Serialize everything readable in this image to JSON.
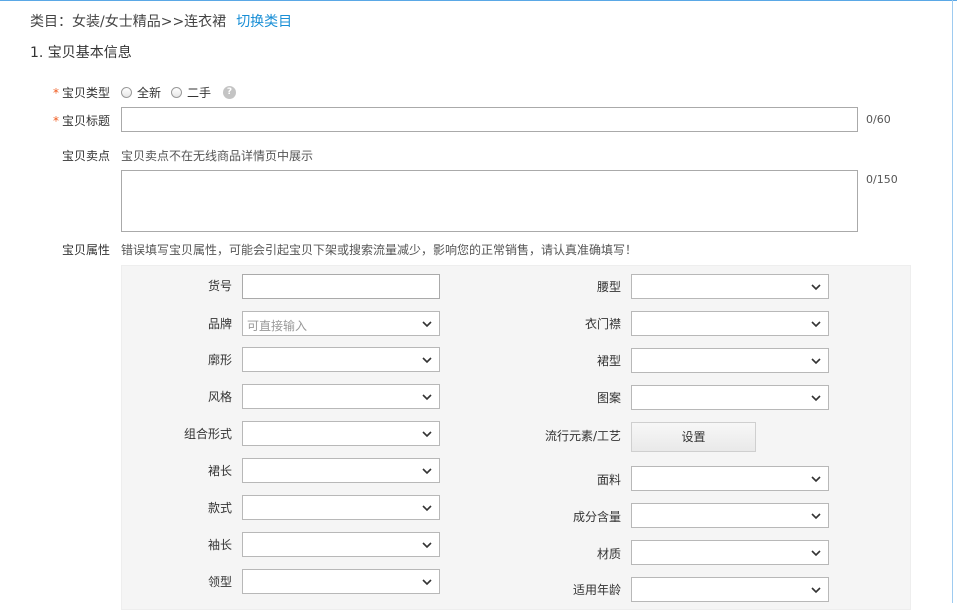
{
  "category": {
    "label": "类目：女装/女士精品>>连衣裙",
    "switch_link": "切换类目"
  },
  "section": {
    "title": "1. 宝贝基本信息"
  },
  "item_type": {
    "label": "宝贝类型",
    "required_mark": "*",
    "options": [
      {
        "label": "全新"
      },
      {
        "label": "二手"
      }
    ],
    "help_icon": "?"
  },
  "item_title": {
    "label": "宝贝标题",
    "required_mark": "*",
    "value": "",
    "counter": "0/60"
  },
  "selling_point": {
    "label": "宝贝卖点",
    "hint": "宝贝卖点不在无线商品详情页中展示",
    "value": "",
    "counter": "0/150"
  },
  "attributes": {
    "label": "宝贝属性",
    "warning": "错误填写宝贝属性，可能会引起宝贝下架或搜索流量减少，影响您的正常销售，请认真准确填写！",
    "left": [
      {
        "label": "货号",
        "kind": "text",
        "value": ""
      },
      {
        "label": "品牌",
        "kind": "select",
        "placeholder": "可直接输入"
      },
      {
        "label": "廓形",
        "kind": "select",
        "value": ""
      },
      {
        "label": "风格",
        "kind": "select",
        "value": ""
      },
      {
        "label": "组合形式",
        "kind": "select",
        "value": ""
      },
      {
        "label": "裙长",
        "kind": "select",
        "value": ""
      },
      {
        "label": "款式",
        "kind": "select",
        "value": ""
      },
      {
        "label": "袖长",
        "kind": "select",
        "value": ""
      },
      {
        "label": "领型",
        "kind": "select",
        "value": ""
      }
    ],
    "right": [
      {
        "label": "腰型",
        "kind": "select",
        "value": ""
      },
      {
        "label": "衣门襟",
        "kind": "select",
        "value": ""
      },
      {
        "label": "裙型",
        "kind": "select",
        "value": ""
      },
      {
        "label": "图案",
        "kind": "select",
        "value": ""
      },
      {
        "label": "流行元素/工艺",
        "kind": "button",
        "button_label": "设置"
      },
      {
        "label": "面料",
        "kind": "select",
        "value": ""
      },
      {
        "label": "成分含量",
        "kind": "select",
        "value": ""
      },
      {
        "label": "材质",
        "kind": "select",
        "value": ""
      },
      {
        "label": "适用年龄",
        "kind": "select",
        "value": ""
      }
    ]
  },
  "colors": {
    "link": "#1a8fd6",
    "required": "#f05a1e",
    "panel_bg": "#f5f5f5"
  }
}
